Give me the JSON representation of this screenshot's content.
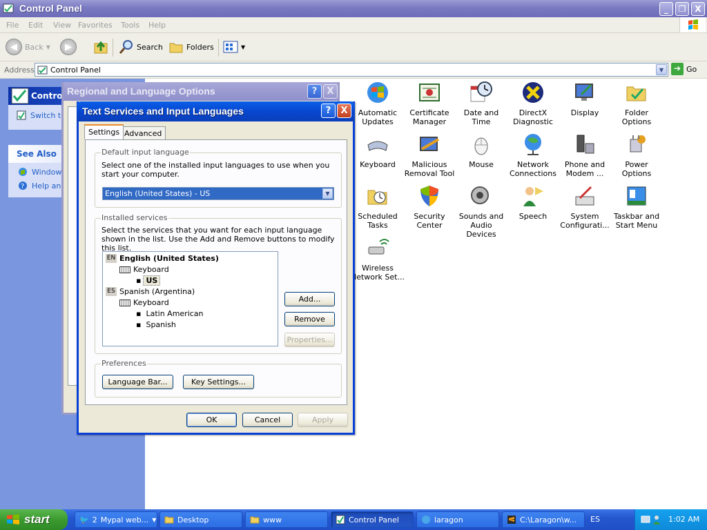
{
  "window": {
    "title": "Control Panel",
    "minimize": "_",
    "maximize": "❐",
    "close": "X"
  },
  "menu": [
    "File",
    "Edit",
    "View",
    "Favorites",
    "Tools",
    "Help"
  ],
  "toolbar": {
    "back": "Back",
    "search": "Search",
    "folders": "Folders"
  },
  "address": {
    "label": "Address",
    "value": "Control Panel",
    "go": "Go"
  },
  "left_pane": {
    "control_panel_title": "Control",
    "switch_view": "Switch to",
    "see_also_title": "See Also",
    "see_also_items": [
      "Windows",
      "Help and"
    ]
  },
  "control_panel_items": [
    {
      "label": "Automatic Updates",
      "icon": "windows-update-icon"
    },
    {
      "label": "Certificate Manager",
      "icon": "certificate-icon"
    },
    {
      "label": "Date and Time",
      "icon": "clock-icon"
    },
    {
      "label": "DirectX Diagnostic",
      "icon": "directx-icon"
    },
    {
      "label": "Display",
      "icon": "display-icon"
    },
    {
      "label": "Folder Options",
      "icon": "folder-options-icon"
    },
    {
      "label": "Keyboard",
      "icon": "keyboard-icon"
    },
    {
      "label": "Malicious Removal Tool",
      "icon": "malicious-removal-icon"
    },
    {
      "label": "Mouse",
      "icon": "mouse-icon"
    },
    {
      "label": "Network Connections",
      "icon": "network-icon"
    },
    {
      "label": "Phone and Modem ...",
      "icon": "phone-modem-icon"
    },
    {
      "label": "Power Options",
      "icon": "power-icon"
    },
    {
      "label": "Scheduled Tasks",
      "icon": "scheduled-tasks-icon"
    },
    {
      "label": "Security Center",
      "icon": "shield-icon"
    },
    {
      "label": "Sounds and Audio Devices",
      "icon": "speaker-icon"
    },
    {
      "label": "Speech",
      "icon": "speech-icon"
    },
    {
      "label": "System Configurati...",
      "icon": "system-config-icon"
    },
    {
      "label": "Taskbar and Start Menu",
      "icon": "taskbar-icon"
    },
    {
      "label": "Wireless Network Set...",
      "icon": "wireless-icon"
    }
  ],
  "regional_dialog": {
    "title": "Regional and Language Options",
    "help": "?",
    "close": "X"
  },
  "text_services_dialog": {
    "title": "Text Services and Input Languages",
    "help": "?",
    "close": "X",
    "tabs": [
      "Settings",
      "Advanced"
    ],
    "default_input": {
      "group_title": "Default input language",
      "description": "Select one of the installed input languages to use when you start your computer.",
      "selected": "English (United States) - US"
    },
    "installed": {
      "group_title": "Installed services",
      "description": "Select the services that you want for each input language shown in the list. Use the Add and Remove buttons to modify this list.",
      "tree": [
        {
          "code": "EN",
          "language": "English (United States)",
          "keyboard": "Keyboard",
          "layouts": [
            "US"
          ]
        },
        {
          "code": "ES",
          "language": "Spanish (Argentina)",
          "keyboard": "Keyboard",
          "layouts": [
            "Latin American",
            "Spanish"
          ]
        }
      ],
      "add": "Add...",
      "remove": "Remove",
      "properties": "Properties..."
    },
    "preferences": {
      "group_title": "Preferences",
      "language_bar": "Language Bar...",
      "key_settings": "Key Settings..."
    },
    "ok": "OK",
    "cancel": "Cancel",
    "apply": "Apply"
  },
  "taskbar": {
    "start": "start",
    "tasks": [
      {
        "label": "Mypal web...",
        "prefix": "2"
      },
      {
        "label": "Desktop"
      },
      {
        "label": "www"
      },
      {
        "label": "Control Panel"
      },
      {
        "label": "laragon"
      },
      {
        "label": "C:\\Laragon\\w..."
      }
    ],
    "language_indicator": "ES",
    "clock": "1:02 AM"
  }
}
